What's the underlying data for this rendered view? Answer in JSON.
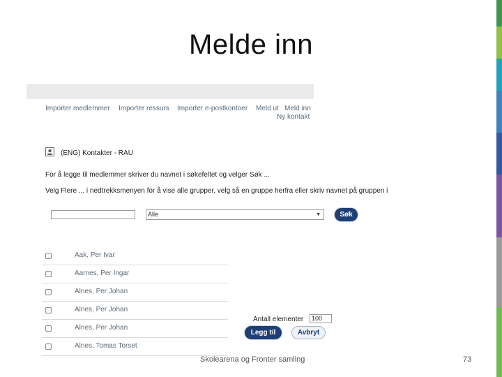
{
  "slide": {
    "title": "Melde inn",
    "footer": "Skolearena og Fronter samling",
    "page_number": "73"
  },
  "toolbar": {
    "import_members": "Importer medlemmer",
    "import_resource": "Importer ressurs",
    "import_email": "Importer e-postkontoer",
    "unregister": "Meld ut",
    "register": "Meld inn",
    "new_contact": "Ny kontakt"
  },
  "contact": {
    "title": "(ENG) Kontakter - RAU",
    "instruction_1": "For å legge til medlemmer skriver du navnet i søkefeltet og velger Søk ...",
    "instruction_2": "Velg Flere ... i nedtrekksmenyen for å vise alle grupper, velg så en gruppe herfra eller skriv navnet på gruppen i"
  },
  "search": {
    "input_value": "",
    "select_value": "Alle",
    "search_button": "Søk"
  },
  "members": [
    {
      "name": "Aak, Per Ivar"
    },
    {
      "name": "Aarnes, Per Ingar"
    },
    {
      "name": "Alnes, Per Johan"
    },
    {
      "name": "Alnes, Per Johan"
    },
    {
      "name": "Alnes, Per Johan"
    },
    {
      "name": "Alnes, Tomas Torset"
    }
  ],
  "actions": {
    "count_label": "Antall elementer",
    "count_value": "100",
    "add_button": "Legg til",
    "cancel_button": "Avbryt"
  },
  "colors": {
    "button_dark": "#1f3f74",
    "link_text": "#5a6a7a",
    "stripe": [
      "#3a9a4a",
      "#8fc23f",
      "#19a6c4",
      "#3a84c6",
      "#2e5aa8",
      "#7a54a4",
      "#9b9b9b",
      "#6dbf4a"
    ]
  }
}
